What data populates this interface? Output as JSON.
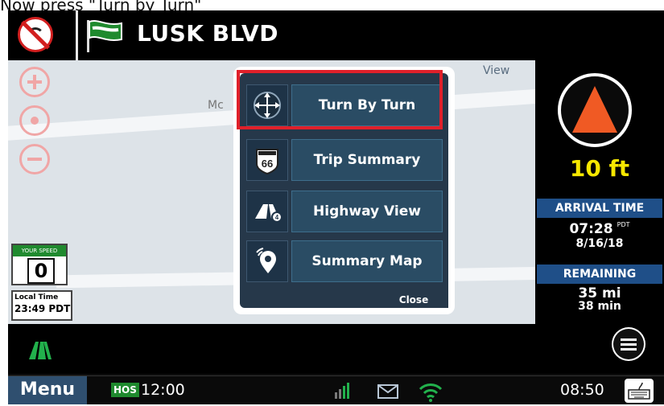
{
  "caption": "Now press \"Turn by Turn\"",
  "topbar": {
    "street": "LUSK BLVD"
  },
  "map": {
    "road_label": "Mc",
    "view_label": "View",
    "speed_header": "YOUR SPEED",
    "speed_value": "0",
    "local_time_label": "Local Time",
    "local_time_value": "23:49 PDT"
  },
  "popup": {
    "items": [
      {
        "label": "Turn By Turn",
        "icon": "crosshair-arrows-icon",
        "highlighted": true
      },
      {
        "label": "Trip Summary",
        "icon": "route-66-shield-icon"
      },
      {
        "label": "Highway View",
        "icon": "truck-highway-icon"
      },
      {
        "label": "Summary Map",
        "icon": "map-pin-icon"
      }
    ],
    "close_label": "Close"
  },
  "right_panel": {
    "distance": "10 ft",
    "arrival_header": "ARRIVAL TIME",
    "arrival_time": "07:28",
    "arrival_tz": "PDT",
    "arrival_date": "8/16/18",
    "remaining_header": "REMAINING",
    "remaining_distance": "35 mi",
    "remaining_time": "38 min"
  },
  "statusbar": {
    "menu_label": "Menu",
    "hos_badge": "HOS",
    "hos_time": "12:00",
    "clock": "08:50"
  },
  "colors": {
    "highlight": "#e0202a",
    "menu_bg": "#26384a",
    "distance_yellow": "#f6e700",
    "arrow_orange": "#f05a24",
    "header_blue": "#1f4f88"
  }
}
